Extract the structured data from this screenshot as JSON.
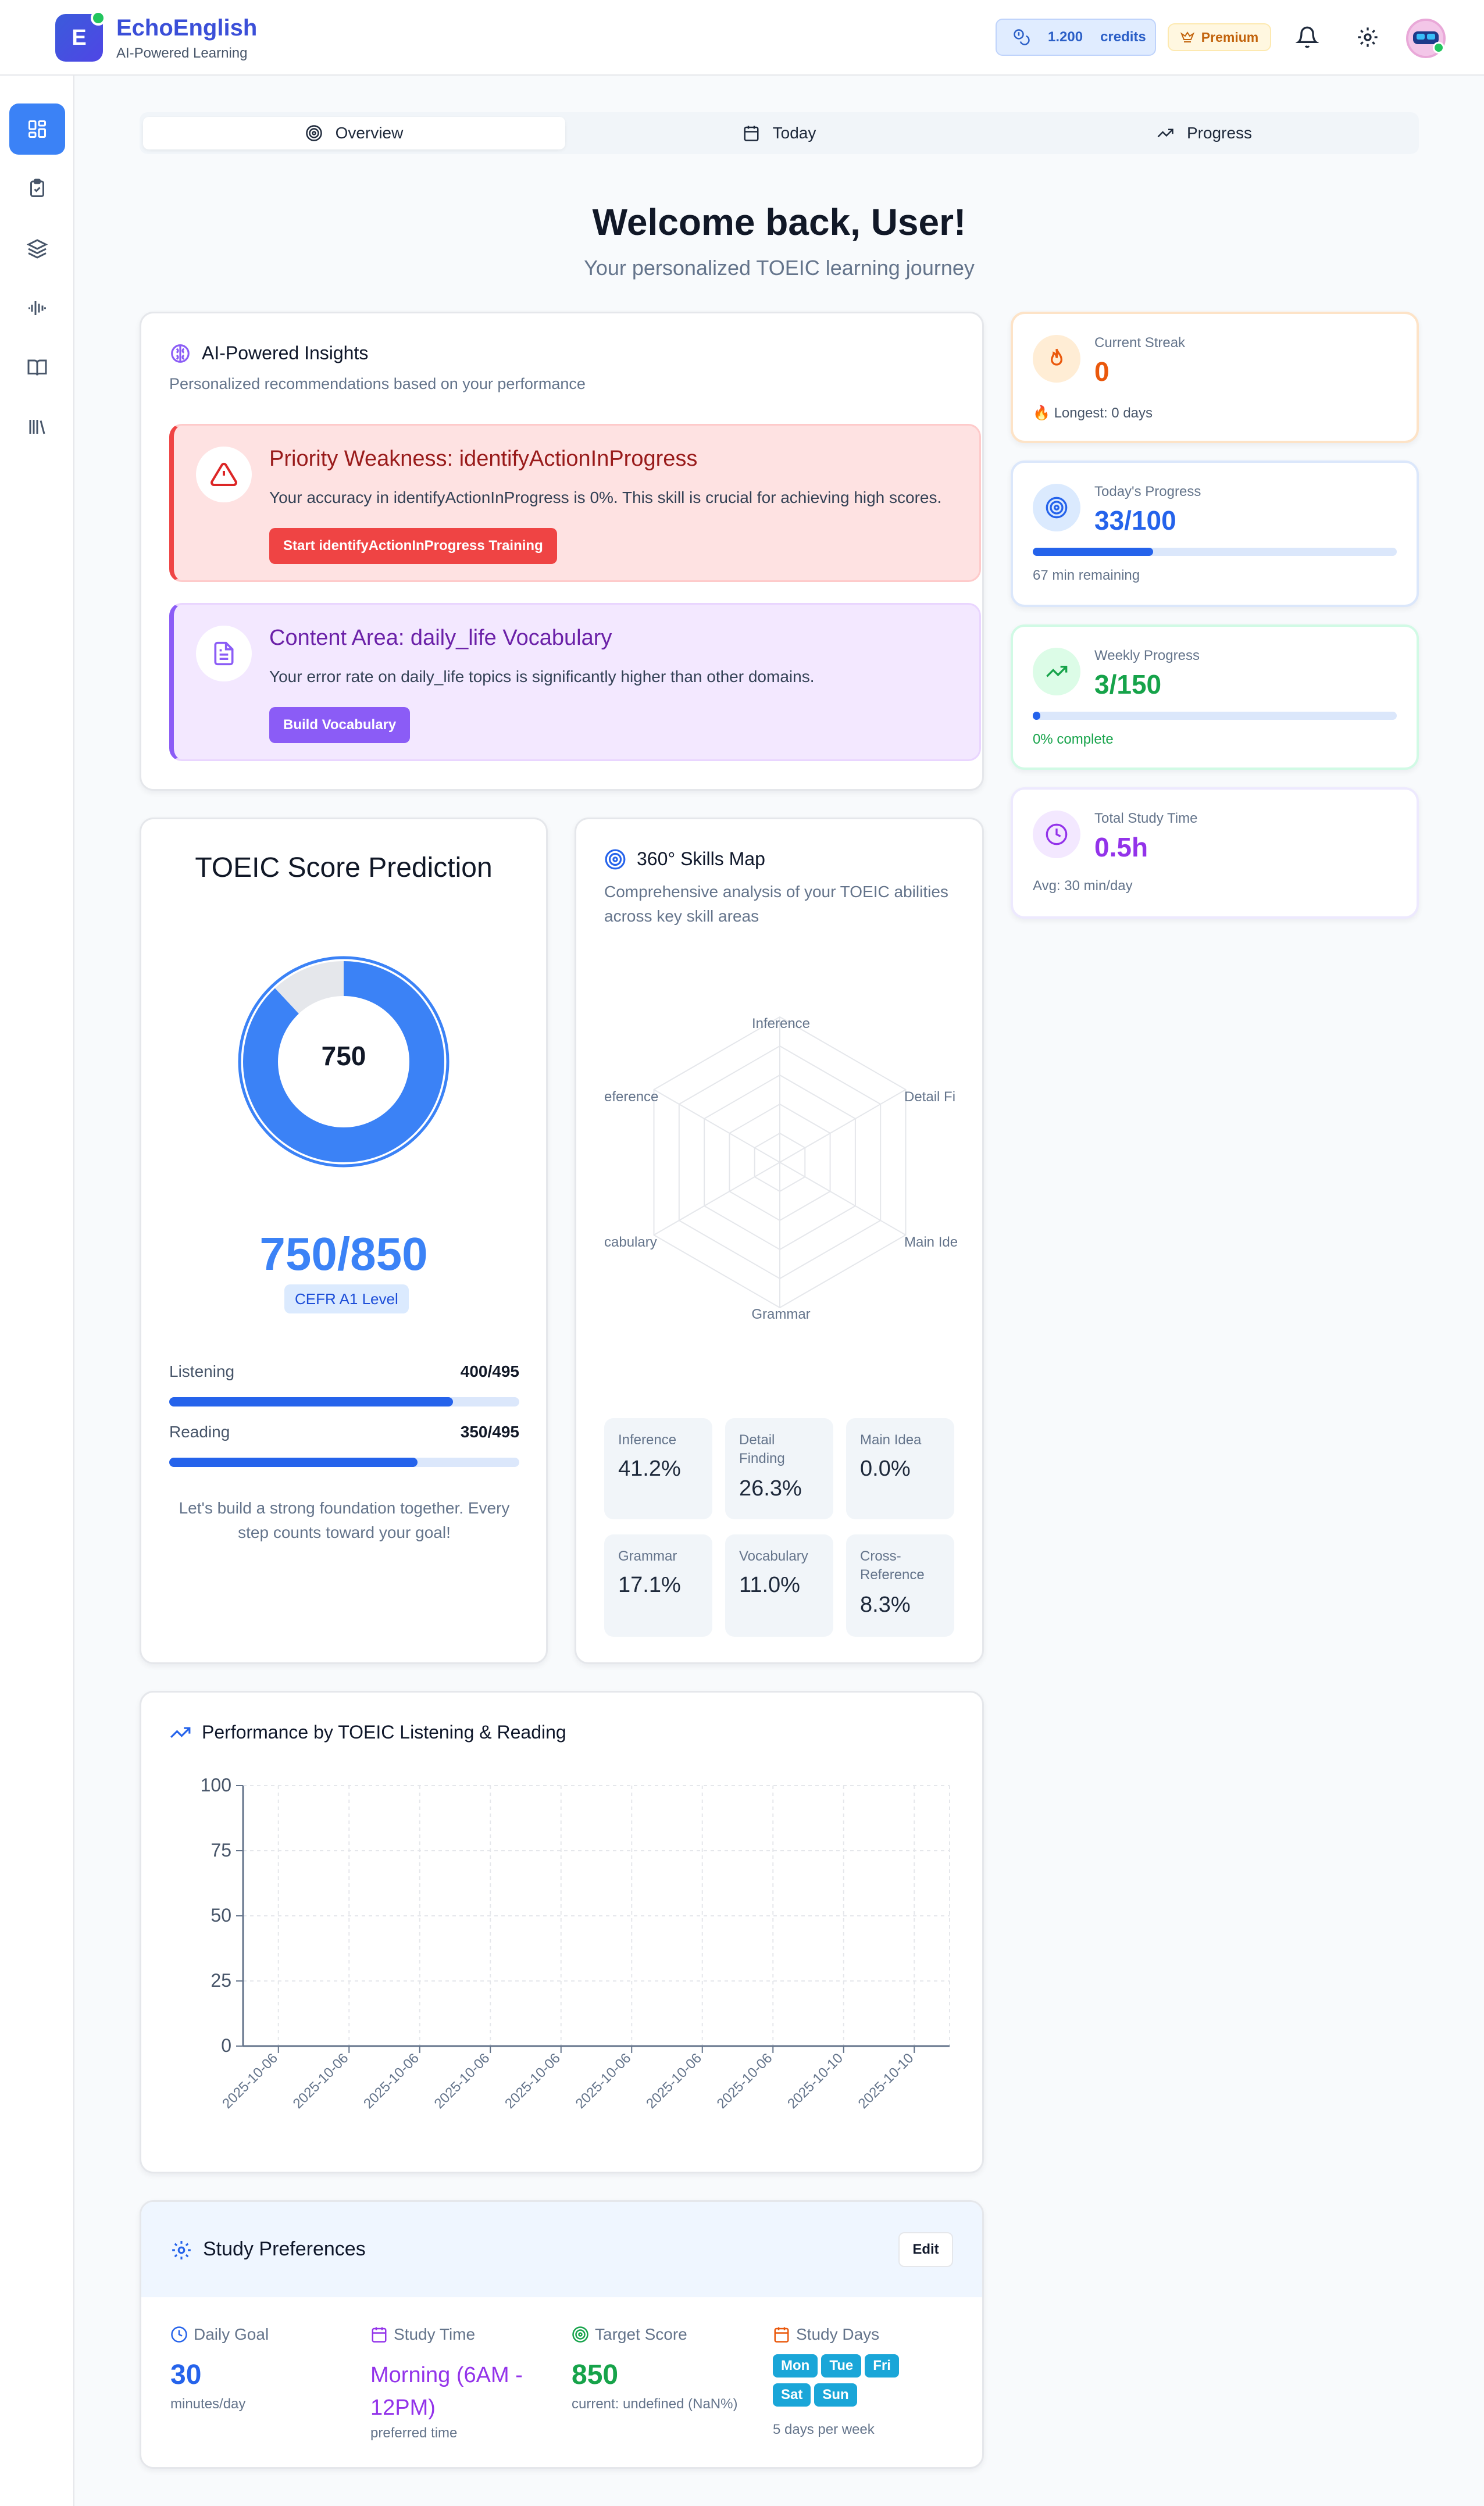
{
  "header": {
    "logo_letter": "E",
    "app_title": "EchoEnglish",
    "app_subtitle": "AI-Powered Learning",
    "credits_value": "1.200",
    "credits_label": "credits",
    "premium_label": "Premium"
  },
  "tabs": [
    {
      "label": "Overview",
      "icon": "target-icon"
    },
    {
      "label": "Today",
      "icon": "calendar-icon"
    },
    {
      "label": "Progress",
      "icon": "trending-up-icon"
    }
  ],
  "welcome": {
    "title": "Welcome back, User!",
    "subtitle": "Your personalized TOEIC learning journey"
  },
  "insights": {
    "title": "AI-Powered Insights",
    "subtitle": "Personalized recommendations based on your performance",
    "alerts": [
      {
        "title": "Priority Weakness: identifyActionInProgress",
        "text": "Your accuracy in identifyActionInProgress is 0%. This skill is crucial for achieving high scores.",
        "button": "Start identifyActionInProgress Training",
        "color": "#dc2626"
      },
      {
        "title": "Content Area: daily_life Vocabulary",
        "text": "Your error rate on daily_life topics is significantly higher than other domains.",
        "button": "Build Vocabulary",
        "color": "#8b5cf6"
      }
    ]
  },
  "stats": {
    "streak": {
      "label": "Current Streak",
      "value": "0",
      "foot": "Longest: 0 days"
    },
    "today": {
      "label": "Today's Progress",
      "value": "33/100",
      "foot": "67 min remaining",
      "progress": 0.33
    },
    "weekly": {
      "label": "Weekly Progress",
      "value": "3/150",
      "foot": "0% complete",
      "progress": 0.02
    },
    "study": {
      "label": "Total Study Time",
      "value": "0.5h",
      "foot": "Avg: 30 min/day"
    }
  },
  "prediction": {
    "title": "TOEIC Score Prediction",
    "ring_value": "750",
    "ring_fraction": 0.88,
    "score": "750/850",
    "cefr": "CEFR A1 Level",
    "listening_label": "Listening",
    "listening_value": "400/495",
    "listening_fraction": 0.81,
    "reading_label": "Reading",
    "reading_value": "350/495",
    "reading_fraction": 0.71,
    "message": "Let's build a strong foundation together. Every step counts toward your goal!"
  },
  "skills": {
    "title": "360° Skills Map",
    "subtitle": "Comprehensive analysis of your TOEIC abilities across key skill areas",
    "radar_labels": [
      "Inference",
      "Detail Fi",
      "Main Ide",
      "Grammar",
      "cabulary",
      "eference"
    ],
    "tiles": [
      {
        "label": "Inference",
        "value": "41.2%"
      },
      {
        "label": "Detail Finding",
        "value": "26.3%"
      },
      {
        "label": "Main Idea",
        "value": "0.0%"
      },
      {
        "label": "Grammar",
        "value": "17.1%"
      },
      {
        "label": "Vocabulary",
        "value": "11.0%"
      },
      {
        "label": "Cross-Reference",
        "value": "8.3%"
      }
    ]
  },
  "performance": {
    "title": "Performance by TOEIC Listening & Reading"
  },
  "chart_data": {
    "type": "line",
    "title": "Performance by TOEIC Listening & Reading",
    "categories": [
      "2025-10-06",
      "2025-10-06",
      "2025-10-06",
      "2025-10-06",
      "2025-10-06",
      "2025-10-06",
      "2025-10-06",
      "2025-10-06",
      "2025-10-10",
      "2025-10-10"
    ],
    "y_ticks": [
      "0",
      "25",
      "50",
      "75",
      "100"
    ],
    "ylim": [
      0,
      100
    ],
    "grid": true,
    "series": []
  },
  "preferences": {
    "title": "Study Preferences",
    "edit_label": "Edit",
    "daily_goal_label": "Daily Goal",
    "daily_goal_value": "30",
    "daily_goal_unit": "minutes/day",
    "study_time_label": "Study Time",
    "study_time_value": "Morning (6AM - 12PM)",
    "study_time_sub": "preferred time",
    "target_label": "Target Score",
    "target_value": "850",
    "target_sub": "current: undefined (NaN%)",
    "days_label": "Study Days",
    "days": [
      "Mon",
      "Tue",
      "Fri",
      "Sat",
      "Sun"
    ],
    "days_sub": "5 days per week"
  }
}
